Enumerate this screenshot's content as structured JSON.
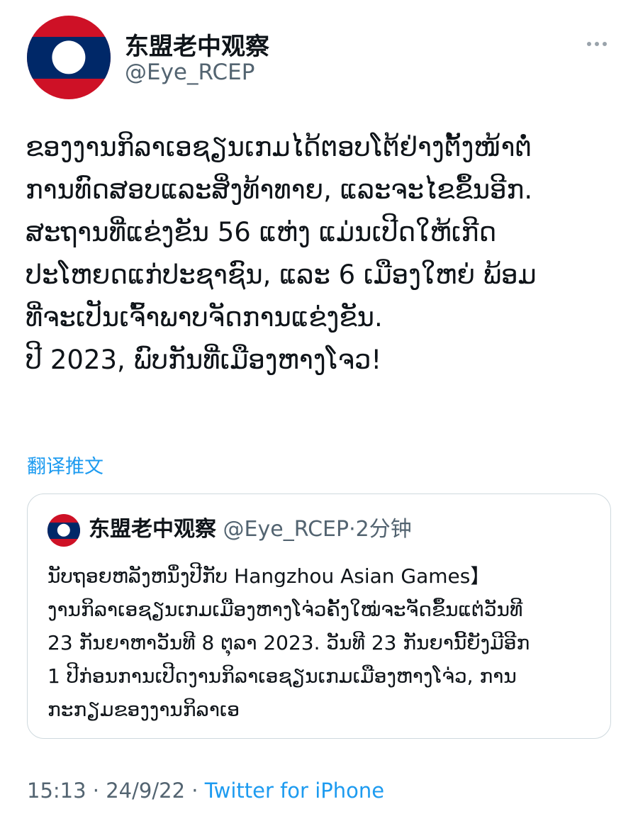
{
  "author": {
    "name": "东盟老中观察",
    "handle": "@Eye_RCEP",
    "avatar_colors": {
      "red": "#ce1126",
      "blue": "#002868",
      "white": "#ffffff"
    }
  },
  "more_icon": "more-horizontal-icon",
  "tweet": {
    "lines": [
      "ຂອງງານກິລາເອຊຽນເກມໄດ້ຕອບໂຕ້ຢ່າງຕັ້ງໜ້າຕໍ່",
      "ການທົດສອບແລະສິ່ງທ້າທາຍ, ແລະຈະໄຂຂຶ້ນອີກ.",
      "ສະຖານທີ່ແຂ່ງຂັນ 56 ແຫ່ງ ແມ່ນເປີດໃຫ້ເກີດ",
      "ປະໂຫຍດແກ່ປະຊາຊົນ, ແລະ 6 ເມືອງໃຫຍ່ ພ້ອມ",
      "ທີ່ຈະເປັນເຈົ້າພາບຈັດການແຂ່ງຂັນ.",
      " ປີ 2023, ພົບກັນທີ່ເມືອງຫາງໂຈວ!"
    ],
    "translate_label": "翻译推文"
  },
  "quoted": {
    "name": "东盟老中观察",
    "handle": "@Eye_RCEP",
    "separator": "·",
    "time": "2分钟",
    "lines": [
      "ນັບຖອຍຫລັງຫນຶ່ງປີກັບ Hangzhou Asian Games】",
      " ງານກິລາເອຊຽນເກມເມືອງຫາງໂຈ່ວຄັ້ງໃໝ່ຈະຈັດຂຶ້ນແຕ່ວັນທີ",
      "23 ກັນຍາຫາວັນທີ 8 ຕຸລາ 2023.  ວັນທີ 23 ກັນຍານີ້ຍັງມີອີກ",
      "1 ປີກ່ອນການເປີດງານກິລາເອຊຽນເກມເມືອງຫາງໂຈ່ວ, ການ",
      "ກະກຽມຂອງງານກິລາເອ"
    ]
  },
  "meta": {
    "time": "15:13",
    "separator1": " · ",
    "date": "24/9/22",
    "separator2": " · ",
    "source": "Twitter for iPhone"
  },
  "colors": {
    "link": "#1d9bf0",
    "secondary_text": "#536471",
    "border": "#cfd9de"
  }
}
